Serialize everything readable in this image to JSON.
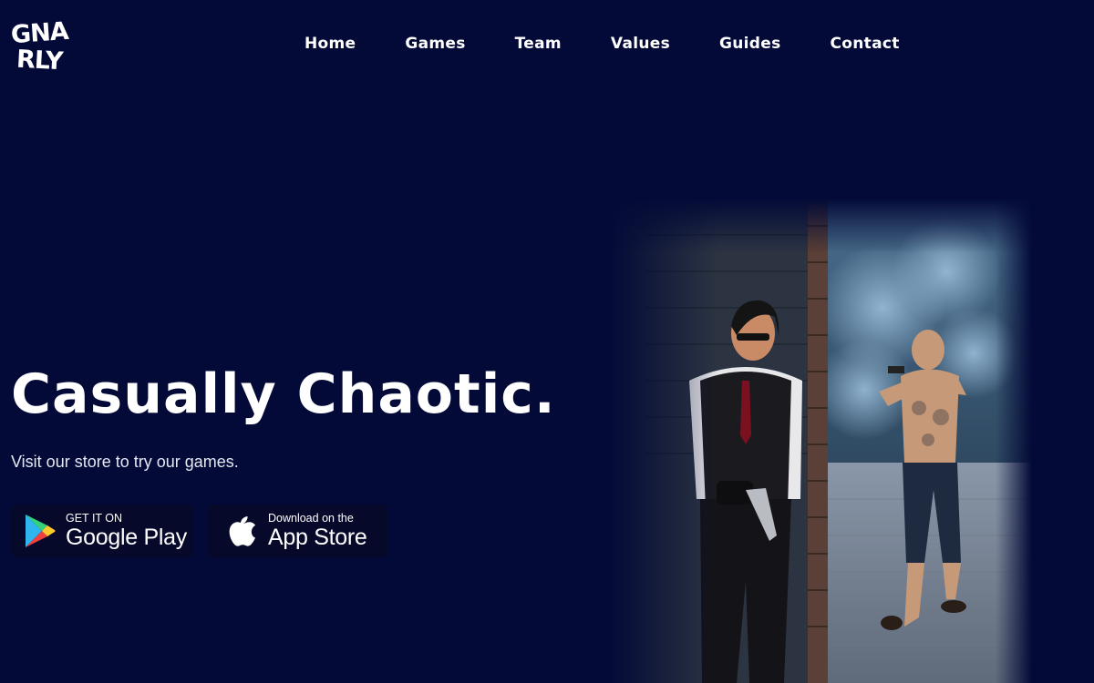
{
  "logo": {
    "line1": "GNA",
    "line2": "RLY"
  },
  "nav": {
    "items": [
      {
        "label": "Home"
      },
      {
        "label": "Games"
      },
      {
        "label": "Team"
      },
      {
        "label": "Values"
      },
      {
        "label": "Guides"
      },
      {
        "label": "Contact"
      }
    ]
  },
  "hero": {
    "title": "Casually Chaotic.",
    "subtitle": "Visit our store to try our games."
  },
  "store_buttons": {
    "google": {
      "small": "GET IT ON",
      "big": "Google Play",
      "icon": "google-play-icon"
    },
    "apple": {
      "small": "Download on the",
      "big": "App Store",
      "icon": "apple-icon"
    }
  },
  "colors": {
    "background": "#030a37",
    "text": "#ffffff",
    "button_bg": "#07092a"
  }
}
